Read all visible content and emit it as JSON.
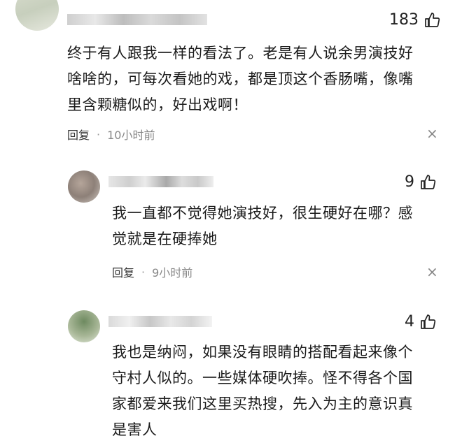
{
  "comments": [
    {
      "likes": "183",
      "text_lines": [
        "终于有人跟我一样的看法了。老是有人说余男演技好",
        "啥啥的，可每次看她的戏，都是顶这个香肠嘴，像嘴",
        "里含颗糖似的，好出戏啊！"
      ],
      "reply_label": "回复",
      "separator": "·",
      "time": "10小时前",
      "close_glyph": "×"
    },
    {
      "likes": "9",
      "text_lines": [
        "我一直都不觉得她演技好，很生硬好在哪？感",
        "觉就是在硬捧她"
      ],
      "reply_label": "回复",
      "separator": "·",
      "time": "9小时前",
      "close_glyph": "×"
    },
    {
      "likes": "4",
      "text_lines": [
        "我也是纳闷，如果没有眼睛的搭配看起来像个",
        "守村人似的。一些媒体硬吹捧。怪不得各个国",
        "家都爱来我们这里买热搜，先入为主的意识真",
        "是害人"
      ]
    }
  ],
  "icons": {
    "like": "thumbs-up-icon",
    "close": "close-icon"
  }
}
